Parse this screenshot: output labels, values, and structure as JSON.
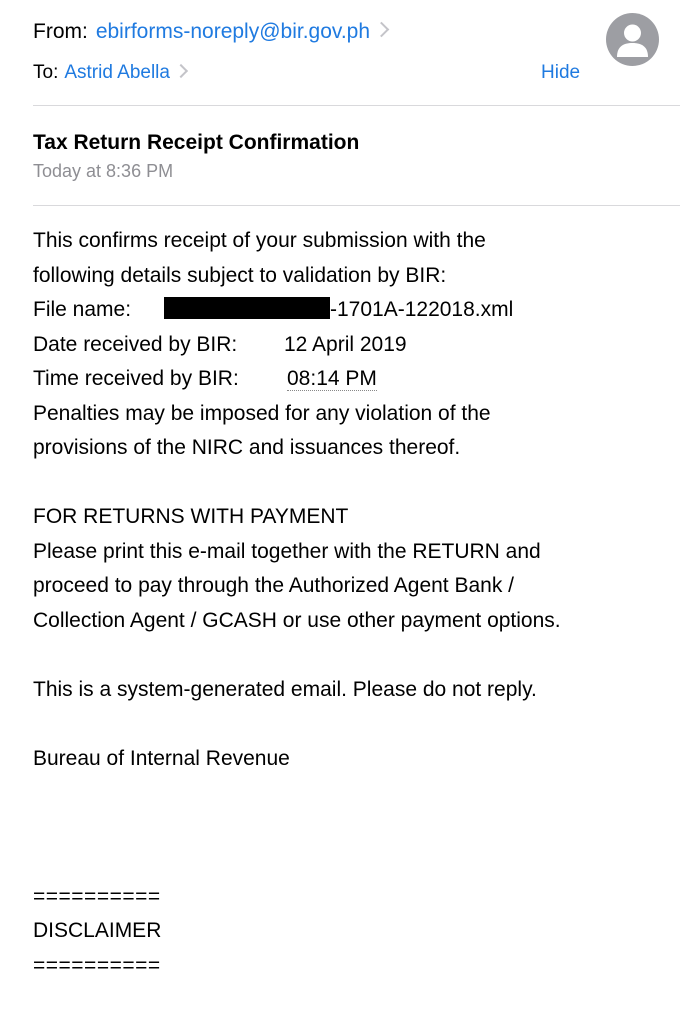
{
  "header": {
    "from_label": "From:",
    "from_address": "ebirforms-noreply@bir.gov.ph",
    "to_label": "To:",
    "to_name": "Astrid Abella",
    "hide_label": "Hide"
  },
  "message": {
    "subject": "Tax Return Receipt Confirmation",
    "timestamp": "Today at 8:36 PM"
  },
  "body": {
    "line1": "This confirms receipt of your submission with the",
    "line2": "following details subject to validation by BIR:",
    "file_label": "File name:",
    "file_suffix": "-1701A-122018.xml",
    "date_label": "Date received by BIR:",
    "date_value": "12 April 2019",
    "time_label": "Time received by BIR:",
    "time_value": "08:14 PM",
    "line6": "Penalties may be imposed for any violation of the",
    "line7": "provisions of the NIRC and issuances thereof.",
    "payment_heading": "FOR RETURNS WITH PAYMENT",
    "payment_line1": "Please print this e-mail together with the RETURN and",
    "payment_line2": "proceed to pay through the Authorized Agent Bank /",
    "payment_line3": "Collection Agent / GCASH or use other payment options.",
    "system_note": "This is a system-generated email. Please do not reply.",
    "signature": "Bureau of Internal Revenue",
    "separator_top": "==========",
    "disclaimer": "DISCLAIMER",
    "separator_bottom": "=========="
  },
  "colors": {
    "link": "#1f7ae0",
    "muted": "#8e8e93",
    "divider": "#d9d9dc",
    "avatar": "#9d9ea3"
  },
  "icons": {
    "avatar": "person-silhouette-icon",
    "chevron": "chevron-right-icon"
  }
}
